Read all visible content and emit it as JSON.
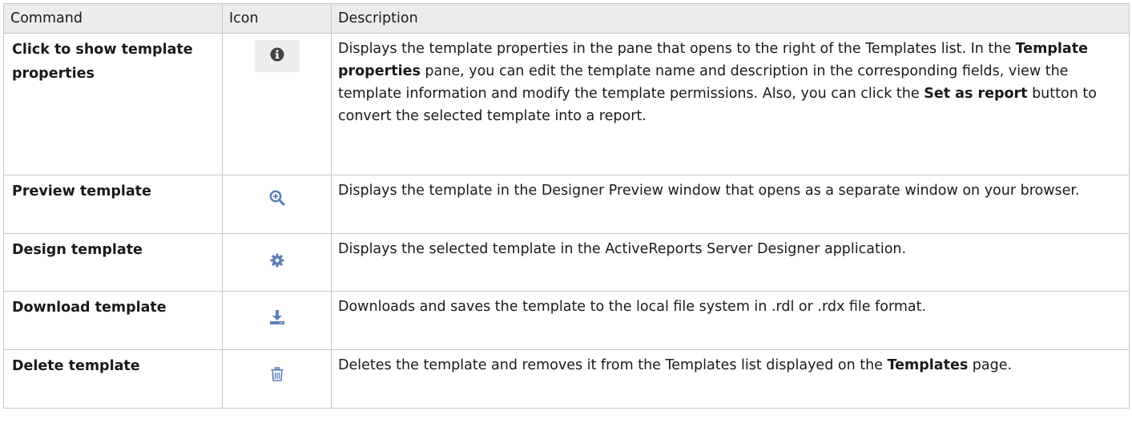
{
  "header": {
    "command": "Command",
    "icon": "Icon",
    "description": "Description"
  },
  "rows": [
    {
      "command": "Click to show template properties",
      "icon": "info-icon",
      "desc_1": "Displays the template properties in the pane that opens to the right of the Templates list. In the ",
      "desc_b1": "Template properties",
      "desc_2": " pane, you can edit the template name and description in the corresponding fields, view the template information and modify the template permissions. Also, you can click the ",
      "desc_b2": "Set as report",
      "desc_3": " button to convert the selected template into a report."
    },
    {
      "command": "Preview template",
      "icon": "zoom-in-icon",
      "desc_1": "Displays the template in the Designer Preview window that opens as a separate window on your browser."
    },
    {
      "command": "Design template",
      "icon": "gear-icon",
      "desc_1": "Displays the selected template in the ActiveReports Server Designer application."
    },
    {
      "command": "Download template",
      "icon": "download-icon",
      "desc_1": "Downloads and saves the template to the local file system in .rdl or .rdx file format."
    },
    {
      "command": "Delete template",
      "icon": "trash-icon",
      "desc_1": "Deletes the template and removes it from the Templates list displayed on the ",
      "desc_b1": "Templates",
      "desc_2": " page."
    }
  ],
  "colors": {
    "header_bg": "#ececec",
    "border": "#c8c8c8",
    "info_icon": "#444444",
    "action_icon": "#5b7fb3"
  }
}
